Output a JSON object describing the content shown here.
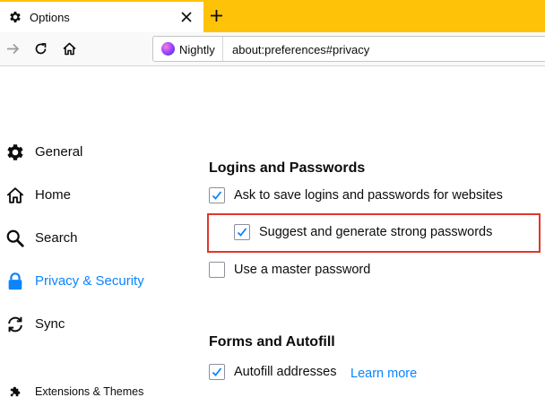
{
  "tab": {
    "title": "Options",
    "icon": "gear-icon"
  },
  "navbar": {
    "identity_label": "Nightly",
    "url": "about:preferences#privacy"
  },
  "sidebar": {
    "items": [
      {
        "label": "General",
        "icon": "gear-icon"
      },
      {
        "label": "Home",
        "icon": "home-icon"
      },
      {
        "label": "Search",
        "icon": "search-icon"
      },
      {
        "label": "Privacy & Security",
        "icon": "lock-icon",
        "selected": true
      },
      {
        "label": "Sync",
        "icon": "sync-icon"
      },
      {
        "label": "Extensions & Themes",
        "icon": "puzzle-icon"
      }
    ]
  },
  "logins": {
    "title": "Logins and Passwords",
    "ask_save": {
      "label": "Ask to save logins and passwords for websites",
      "checked": true
    },
    "suggest": {
      "label": "Suggest and generate strong passwords",
      "checked": true
    },
    "master": {
      "label": "Use a master password",
      "checked": false
    }
  },
  "forms": {
    "title": "Forms and Autofill",
    "autofill": {
      "label": "Autofill addresses",
      "checked": true
    },
    "learn_more": "Learn more"
  },
  "colors": {
    "tabstrip": "#fec309",
    "accent": "#0a84ff",
    "highlight_border": "#e0362c"
  }
}
